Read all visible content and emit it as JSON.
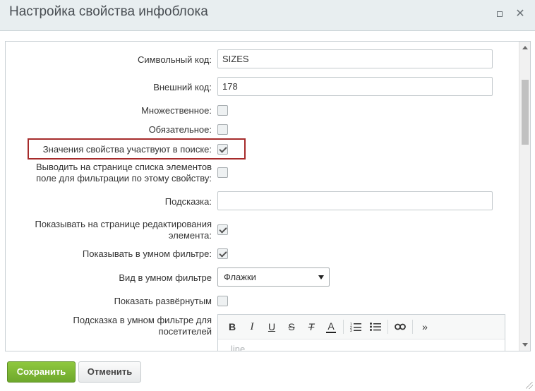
{
  "window": {
    "title": "Настройка свойства инфоблока"
  },
  "form": {
    "code_label": "Символьный код:",
    "code_value": "SIZES",
    "xml_label": "Внешний код:",
    "xml_value": "178",
    "multiple_label": "Множественное:",
    "multiple_checked": false,
    "required_label": "Обязательное:",
    "required_checked": false,
    "searchable_label": "Значения свойства участвуют в поиске:",
    "searchable_checked": true,
    "filtrable_label_line1": "Выводить на странице списка элементов",
    "filtrable_label_line2": "поле для фильтрации по этому свойству:",
    "filtrable_checked": false,
    "hint_label": "Подсказка:",
    "hint_value": "",
    "show_edit_label_line1": "Показывать на странице редактирования",
    "show_edit_label_line2": "элемента:",
    "show_edit_checked": true,
    "smart_filter_label": "Показывать в умном фильтре:",
    "smart_filter_checked": true,
    "smart_view_label": "Вид в умном фильтре",
    "smart_view_value": "Флажки",
    "expanded_label": "Показать развёрнутым",
    "expanded_checked": false,
    "smart_hint_label_line1": "Подсказка в умном фильтре для",
    "smart_hint_label_line2": "посетителей",
    "editor_placeholder": "line"
  },
  "toolbar": {
    "bold": "B",
    "italic": "I",
    "underline": "U",
    "strike": "S",
    "clear": "T",
    "color": "A",
    "more": "»"
  },
  "footer": {
    "save_label": "Сохранить",
    "cancel_label": "Отменить"
  }
}
